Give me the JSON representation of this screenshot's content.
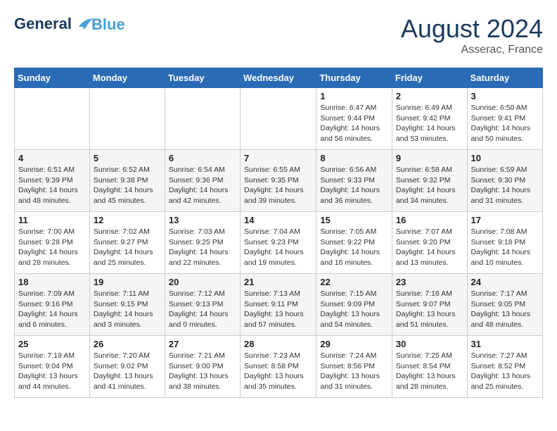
{
  "header": {
    "logo_line1": "General",
    "logo_line2": "Blue",
    "month_year": "August 2024",
    "location": "Asserac, France"
  },
  "days_of_week": [
    "Sunday",
    "Monday",
    "Tuesday",
    "Wednesday",
    "Thursday",
    "Friday",
    "Saturday"
  ],
  "weeks": [
    [
      {
        "day": "",
        "detail": ""
      },
      {
        "day": "",
        "detail": ""
      },
      {
        "day": "",
        "detail": ""
      },
      {
        "day": "",
        "detail": ""
      },
      {
        "day": "1",
        "detail": "Sunrise: 6:47 AM\nSunset: 9:44 PM\nDaylight: 14 hours\nand 56 minutes."
      },
      {
        "day": "2",
        "detail": "Sunrise: 6:49 AM\nSunset: 9:42 PM\nDaylight: 14 hours\nand 53 minutes."
      },
      {
        "day": "3",
        "detail": "Sunrise: 6:50 AM\nSunset: 9:41 PM\nDaylight: 14 hours\nand 50 minutes."
      }
    ],
    [
      {
        "day": "4",
        "detail": "Sunrise: 6:51 AM\nSunset: 9:39 PM\nDaylight: 14 hours\nand 48 minutes."
      },
      {
        "day": "5",
        "detail": "Sunrise: 6:52 AM\nSunset: 9:38 PM\nDaylight: 14 hours\nand 45 minutes."
      },
      {
        "day": "6",
        "detail": "Sunrise: 6:54 AM\nSunset: 9:36 PM\nDaylight: 14 hours\nand 42 minutes."
      },
      {
        "day": "7",
        "detail": "Sunrise: 6:55 AM\nSunset: 9:35 PM\nDaylight: 14 hours\nand 39 minutes."
      },
      {
        "day": "8",
        "detail": "Sunrise: 6:56 AM\nSunset: 9:33 PM\nDaylight: 14 hours\nand 36 minutes."
      },
      {
        "day": "9",
        "detail": "Sunrise: 6:58 AM\nSunset: 9:32 PM\nDaylight: 14 hours\nand 34 minutes."
      },
      {
        "day": "10",
        "detail": "Sunrise: 6:59 AM\nSunset: 9:30 PM\nDaylight: 14 hours\nand 31 minutes."
      }
    ],
    [
      {
        "day": "11",
        "detail": "Sunrise: 7:00 AM\nSunset: 9:28 PM\nDaylight: 14 hours\nand 28 minutes."
      },
      {
        "day": "12",
        "detail": "Sunrise: 7:02 AM\nSunset: 9:27 PM\nDaylight: 14 hours\nand 25 minutes."
      },
      {
        "day": "13",
        "detail": "Sunrise: 7:03 AM\nSunset: 9:25 PM\nDaylight: 14 hours\nand 22 minutes."
      },
      {
        "day": "14",
        "detail": "Sunrise: 7:04 AM\nSunset: 9:23 PM\nDaylight: 14 hours\nand 19 minutes."
      },
      {
        "day": "15",
        "detail": "Sunrise: 7:05 AM\nSunset: 9:22 PM\nDaylight: 14 hours\nand 16 minutes."
      },
      {
        "day": "16",
        "detail": "Sunrise: 7:07 AM\nSunset: 9:20 PM\nDaylight: 14 hours\nand 13 minutes."
      },
      {
        "day": "17",
        "detail": "Sunrise: 7:08 AM\nSunset: 9:18 PM\nDaylight: 14 hours\nand 10 minutes."
      }
    ],
    [
      {
        "day": "18",
        "detail": "Sunrise: 7:09 AM\nSunset: 9:16 PM\nDaylight: 14 hours\nand 6 minutes."
      },
      {
        "day": "19",
        "detail": "Sunrise: 7:11 AM\nSunset: 9:15 PM\nDaylight: 14 hours\nand 3 minutes."
      },
      {
        "day": "20",
        "detail": "Sunrise: 7:12 AM\nSunset: 9:13 PM\nDaylight: 14 hours\nand 0 minutes."
      },
      {
        "day": "21",
        "detail": "Sunrise: 7:13 AM\nSunset: 9:11 PM\nDaylight: 13 hours\nand 57 minutes."
      },
      {
        "day": "22",
        "detail": "Sunrise: 7:15 AM\nSunset: 9:09 PM\nDaylight: 13 hours\nand 54 minutes."
      },
      {
        "day": "23",
        "detail": "Sunrise: 7:16 AM\nSunset: 9:07 PM\nDaylight: 13 hours\nand 51 minutes."
      },
      {
        "day": "24",
        "detail": "Sunrise: 7:17 AM\nSunset: 9:05 PM\nDaylight: 13 hours\nand 48 minutes."
      }
    ],
    [
      {
        "day": "25",
        "detail": "Sunrise: 7:19 AM\nSunset: 9:04 PM\nDaylight: 13 hours\nand 44 minutes."
      },
      {
        "day": "26",
        "detail": "Sunrise: 7:20 AM\nSunset: 9:02 PM\nDaylight: 13 hours\nand 41 minutes."
      },
      {
        "day": "27",
        "detail": "Sunrise: 7:21 AM\nSunset: 9:00 PM\nDaylight: 13 hours\nand 38 minutes."
      },
      {
        "day": "28",
        "detail": "Sunrise: 7:23 AM\nSunset: 8:58 PM\nDaylight: 13 hours\nand 35 minutes."
      },
      {
        "day": "29",
        "detail": "Sunrise: 7:24 AM\nSunset: 8:56 PM\nDaylight: 13 hours\nand 31 minutes."
      },
      {
        "day": "30",
        "detail": "Sunrise: 7:25 AM\nSunset: 8:54 PM\nDaylight: 13 hours\nand 28 minutes."
      },
      {
        "day": "31",
        "detail": "Sunrise: 7:27 AM\nSunset: 8:52 PM\nDaylight: 13 hours\nand 25 minutes."
      }
    ]
  ]
}
